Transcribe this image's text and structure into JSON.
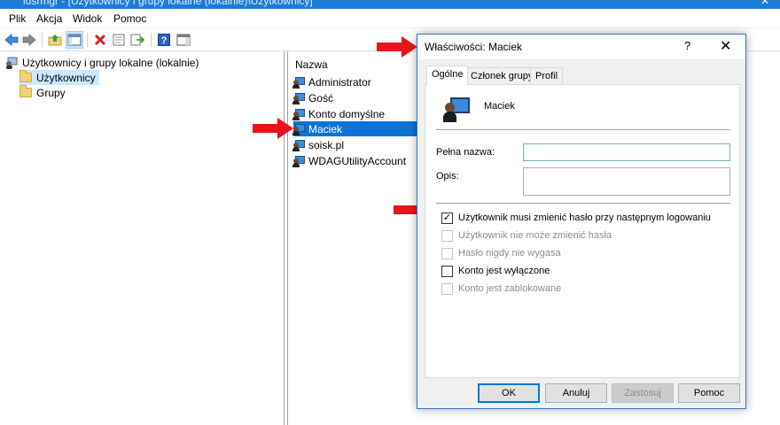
{
  "window": {
    "title": "lusrmgr - [Użytkownicy i grupy lokalne (lokalnie)\\Użytkownicy]",
    "close_glyph": "✕"
  },
  "menu": [
    "Plik",
    "Akcja",
    "Widok",
    "Pomoc"
  ],
  "toolbar": {
    "icons": [
      "back-arrow-icon",
      "forward-arrow-icon",
      "up-folder-icon",
      "show-tree-icon",
      "delete-icon",
      "properties-icon",
      "export-list-icon",
      "help-icon",
      "show-action-pane-icon"
    ]
  },
  "tree": {
    "root": "Użytkownicy i grupy lokalne (lokalnie)",
    "items": [
      "Użytkownicy",
      "Grupy"
    ]
  },
  "list": {
    "header": "Nazwa",
    "users": [
      "Administrator",
      "Gość",
      "Konto domyślne",
      "Maciek",
      "soisk.pl",
      "WDAGUtilityAccount"
    ],
    "selected": "Maciek"
  },
  "dialog": {
    "title": "Właściwości: Maciek",
    "help_glyph": "?",
    "close_glyph": "✕",
    "tabs": [
      "Ogólne",
      "Członek grupy",
      "Profil"
    ],
    "username": "Maciek",
    "full_name_label": "Pełna nazwa:",
    "full_name_value": "",
    "description_label": "Opis:",
    "description_value": "",
    "checkboxes": [
      {
        "label": "Użytkownik musi zmienić hasło przy następnym logowaniu",
        "checked": true,
        "enabled": true
      },
      {
        "label": "Użytkownik nie może zmienić hasła",
        "checked": false,
        "enabled": false
      },
      {
        "label": "Hasło nigdy nie wygasa",
        "checked": false,
        "enabled": false
      },
      {
        "label": "Konto jest wyłączone",
        "checked": false,
        "enabled": true
      },
      {
        "label": "Konto jest zablokowane",
        "checked": false,
        "enabled": false
      }
    ],
    "buttons": {
      "ok": "OK",
      "cancel": "Anuluj",
      "apply": "Zastosuj",
      "help": "Pomoc"
    }
  },
  "annotation_color": "#e8141b"
}
